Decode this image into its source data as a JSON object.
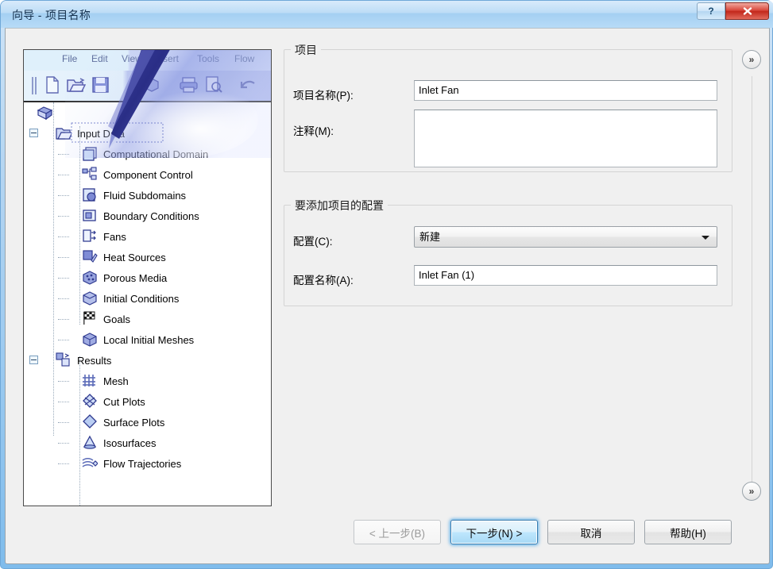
{
  "window": {
    "title": "向导 - 项目名称",
    "help_button": "?",
    "close_button": "✕"
  },
  "left_panel": {
    "menu_items": [
      "File",
      "Edit",
      "View",
      "Insert",
      "Tools",
      "Flow"
    ],
    "tree": [
      {
        "label": "Input Data",
        "level": 1,
        "icon": "folder-open-icon",
        "expander": "minus"
      },
      {
        "label": "Computational Domain",
        "level": 2,
        "icon": "domain-box-icon"
      },
      {
        "label": "Component Control",
        "level": 2,
        "icon": "component-tree-icon"
      },
      {
        "label": "Fluid Subdomains",
        "level": 2,
        "icon": "fluid-subdomain-icon"
      },
      {
        "label": "Boundary Conditions",
        "level": 2,
        "icon": "boundary-condition-icon"
      },
      {
        "label": "Fans",
        "level": 2,
        "icon": "fan-icon"
      },
      {
        "label": "Heat Sources",
        "level": 2,
        "icon": "heat-source-icon"
      },
      {
        "label": "Porous Media",
        "level": 2,
        "icon": "porous-media-icon"
      },
      {
        "label": "Initial Conditions",
        "level": 2,
        "icon": "initial-conditions-icon"
      },
      {
        "label": "Goals",
        "level": 2,
        "icon": "goals-flag-icon"
      },
      {
        "label": "Local Initial Meshes",
        "level": 2,
        "icon": "local-mesh-icon"
      },
      {
        "label": "Results",
        "level": 1,
        "icon": "results-icon",
        "expander": "minus"
      },
      {
        "label": "Mesh",
        "level": 2,
        "icon": "mesh-grid-icon"
      },
      {
        "label": "Cut Plots",
        "level": 2,
        "icon": "cut-plot-icon"
      },
      {
        "label": "Surface Plots",
        "level": 2,
        "icon": "surface-plot-icon"
      },
      {
        "label": "Isosurfaces",
        "level": 2,
        "icon": "isosurface-icon"
      },
      {
        "label": "Flow Trajectories",
        "level": 2,
        "icon": "flow-trajectory-icon"
      }
    ]
  },
  "project_group": {
    "title": "项目",
    "name_label": "项目名称(P):",
    "name_value": "Inlet Fan",
    "comment_label": "注释(M):",
    "comment_value": ""
  },
  "config_group": {
    "title": "要添加项目的配置",
    "config_label": "配置(C):",
    "config_value": "新建",
    "config_options": [
      "新建"
    ],
    "config_name_label": "配置名称(A):",
    "config_name_value": "Inlet Fan (1)"
  },
  "footer": {
    "back": "< 上一步(B)",
    "next": "下一步(N) >",
    "cancel": "取消",
    "help": "帮助(H)"
  },
  "expanders": {
    "top": "»",
    "bottom": "»"
  },
  "colors": {
    "aero_frame": "#9ecbf0",
    "title_text": "#16324f",
    "close_red": "#c2281c",
    "default_button_glow": "#3ca0e6",
    "client_bg": "#f0f0f0"
  }
}
